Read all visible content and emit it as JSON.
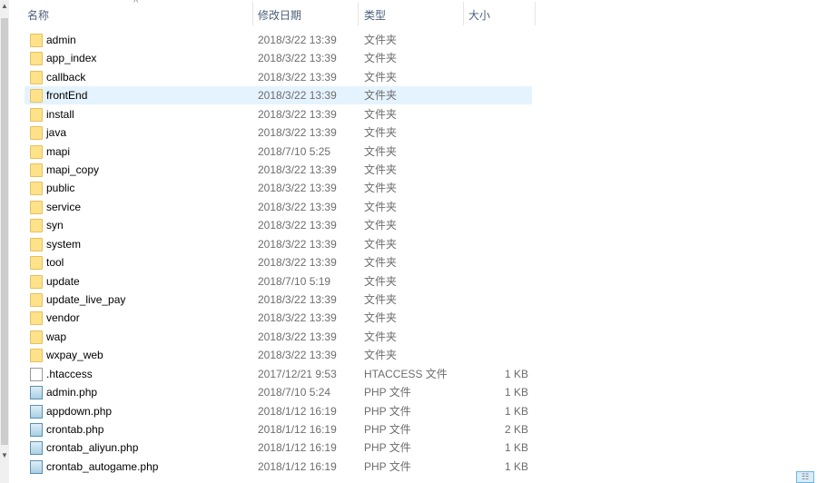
{
  "columns": {
    "name": "名称",
    "date": "修改日期",
    "type": "类型",
    "size": "大小"
  },
  "rows": [
    {
      "name": "admin",
      "date": "2018/3/22 13:39",
      "type": "文件夹",
      "size": "",
      "icon": "folder"
    },
    {
      "name": "app_index",
      "date": "2018/3/22 13:39",
      "type": "文件夹",
      "size": "",
      "icon": "folder"
    },
    {
      "name": "callback",
      "date": "2018/3/22 13:39",
      "type": "文件夹",
      "size": "",
      "icon": "folder"
    },
    {
      "name": "frontEnd",
      "date": "2018/3/22 13:39",
      "type": "文件夹",
      "size": "",
      "icon": "folder",
      "selected": true
    },
    {
      "name": "install",
      "date": "2018/3/22 13:39",
      "type": "文件夹",
      "size": "",
      "icon": "folder"
    },
    {
      "name": "java",
      "date": "2018/3/22 13:39",
      "type": "文件夹",
      "size": "",
      "icon": "folder"
    },
    {
      "name": "mapi",
      "date": "2018/7/10 5:25",
      "type": "文件夹",
      "size": "",
      "icon": "folder"
    },
    {
      "name": "mapi_copy",
      "date": "2018/3/22 13:39",
      "type": "文件夹",
      "size": "",
      "icon": "folder"
    },
    {
      "name": "public",
      "date": "2018/3/22 13:39",
      "type": "文件夹",
      "size": "",
      "icon": "folder"
    },
    {
      "name": "service",
      "date": "2018/3/22 13:39",
      "type": "文件夹",
      "size": "",
      "icon": "folder"
    },
    {
      "name": "syn",
      "date": "2018/3/22 13:39",
      "type": "文件夹",
      "size": "",
      "icon": "folder"
    },
    {
      "name": "system",
      "date": "2018/3/22 13:39",
      "type": "文件夹",
      "size": "",
      "icon": "folder"
    },
    {
      "name": "tool",
      "date": "2018/3/22 13:39",
      "type": "文件夹",
      "size": "",
      "icon": "folder"
    },
    {
      "name": "update",
      "date": "2018/7/10 5:19",
      "type": "文件夹",
      "size": "",
      "icon": "folder"
    },
    {
      "name": "update_live_pay",
      "date": "2018/3/22 13:39",
      "type": "文件夹",
      "size": "",
      "icon": "folder"
    },
    {
      "name": "vendor",
      "date": "2018/3/22 13:39",
      "type": "文件夹",
      "size": "",
      "icon": "folder"
    },
    {
      "name": "wap",
      "date": "2018/3/22 13:39",
      "type": "文件夹",
      "size": "",
      "icon": "folder"
    },
    {
      "name": "wxpay_web",
      "date": "2018/3/22 13:39",
      "type": "文件夹",
      "size": "",
      "icon": "folder"
    },
    {
      "name": ".htaccess",
      "date": "2017/12/21 9:53",
      "type": "HTACCESS 文件",
      "size": "1 KB",
      "icon": "file"
    },
    {
      "name": "admin.php",
      "date": "2018/7/10 5:24",
      "type": "PHP 文件",
      "size": "1 KB",
      "icon": "php"
    },
    {
      "name": "appdown.php",
      "date": "2018/1/12 16:19",
      "type": "PHP 文件",
      "size": "1 KB",
      "icon": "php"
    },
    {
      "name": "crontab.php",
      "date": "2018/1/12 16:19",
      "type": "PHP 文件",
      "size": "2 KB",
      "icon": "php"
    },
    {
      "name": "crontab_aliyun.php",
      "date": "2018/1/12 16:19",
      "type": "PHP 文件",
      "size": "1 KB",
      "icon": "php"
    },
    {
      "name": "crontab_autogame.php",
      "date": "2018/1/12 16:19",
      "type": "PHP 文件",
      "size": "1 KB",
      "icon": "php"
    }
  ]
}
